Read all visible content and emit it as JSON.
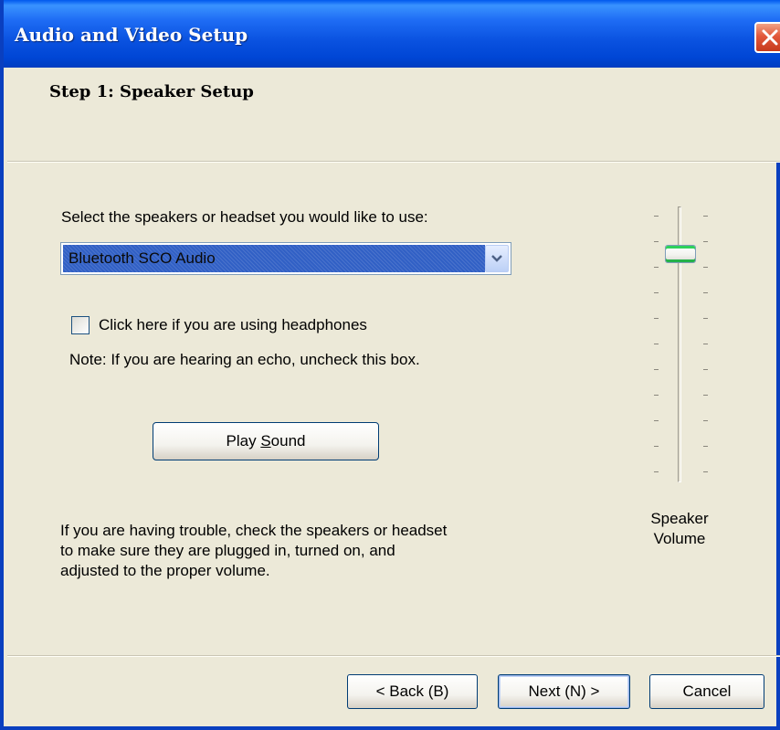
{
  "window": {
    "title": "Audio and Video Setup",
    "close_icon": "close-icon"
  },
  "header": {
    "step_title": "Step 1: Speaker Setup"
  },
  "speakers": {
    "label": "Select the speakers or headset you would like to use:",
    "selected": "Bluetooth SCO Audio",
    "dropdown_icon": "chevron-down-icon"
  },
  "headphones": {
    "checkbox_label": "Click here if you are using headphones",
    "checked": false,
    "note": "Note: If you are hearing an echo, uncheck this box."
  },
  "play_sound": {
    "label_before": "Play ",
    "label_accel": "S",
    "label_after": "ound"
  },
  "trouble": {
    "lines": [
      "If you are having trouble, check the speakers or headset",
      "to make sure they are plugged in, turned on, and",
      "adjusted to the proper volume."
    ]
  },
  "volume": {
    "label_line1": "Speaker",
    "label_line2": "Volume",
    "level_fraction": 0.85
  },
  "footer": {
    "back_label": "< Back (B)",
    "next_label": "Next (N) >",
    "cancel_label": "Cancel"
  },
  "colors": {
    "titlebar": "#0a52e0",
    "dialog_bg": "#ece9d8",
    "selection": "#3160c5",
    "close_button": "#e2583b",
    "slider_thumb_accent": "#24b24a"
  }
}
